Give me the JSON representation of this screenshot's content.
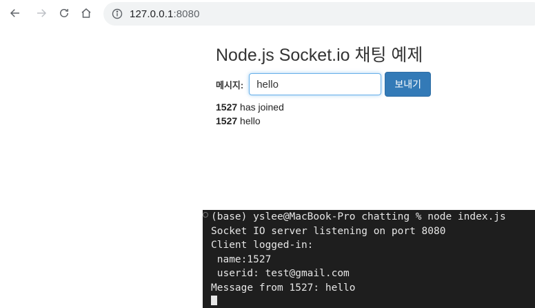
{
  "browser": {
    "url_host": "127.0.0.1",
    "url_port": ":8080"
  },
  "page": {
    "title": "Node.js Socket.io 채팅 예제",
    "message_label": "메시지:",
    "input_value": "hello",
    "send_label": "보내기",
    "messages": [
      {
        "user": "1527",
        "text": "has joined"
      },
      {
        "user": "1527",
        "text": "hello"
      }
    ]
  },
  "terminal": {
    "lines": [
      "(base) yslee@MacBook-Pro chatting % node index.js",
      "Socket IO server listening on port 8080",
      "Client logged-in:",
      " name:1527",
      " userid: test@gmail.com",
      "Message from 1527: hello"
    ]
  }
}
